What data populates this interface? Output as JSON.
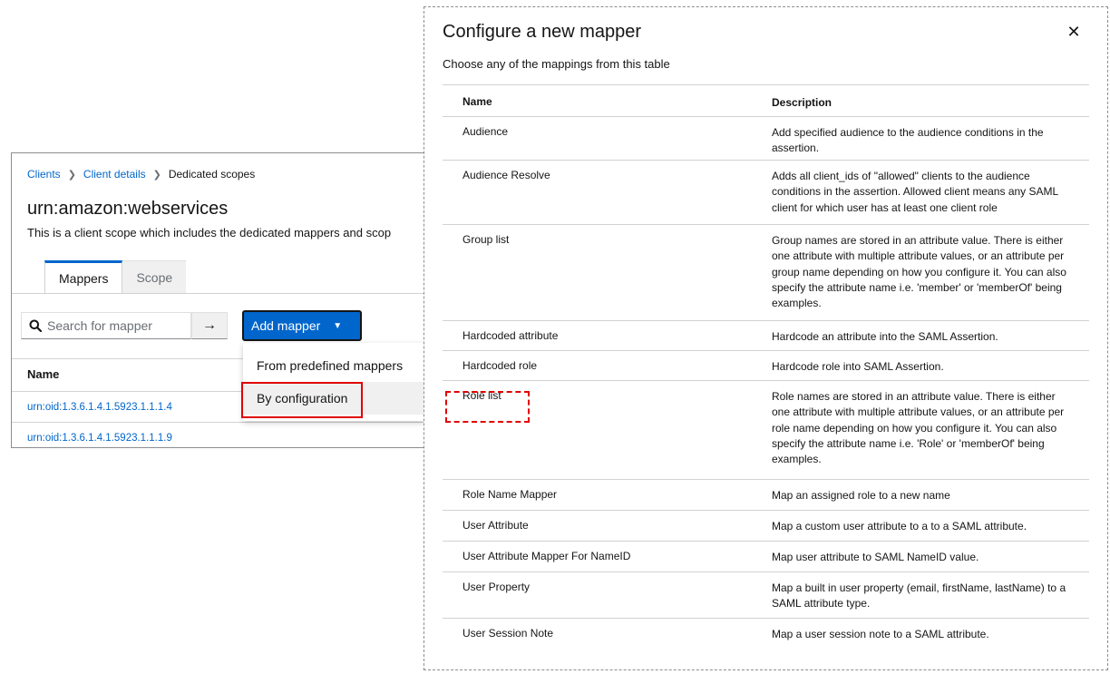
{
  "breadcrumb": {
    "items": [
      "Clients",
      "Client details"
    ],
    "current": "Dedicated scopes"
  },
  "page": {
    "title": "urn:amazon:webservices",
    "subtitle": "This is a client scope which includes the dedicated mappers and scop"
  },
  "tabs": [
    {
      "label": "Mappers",
      "active": true
    },
    {
      "label": "Scope",
      "active": false
    }
  ],
  "search": {
    "placeholder": "Search for mapper",
    "value": ""
  },
  "toolbar": {
    "add_mapper_label": "Add mapper"
  },
  "dropdown": {
    "items": [
      "From predefined mappers",
      "By configuration"
    ],
    "highlighted": "By configuration"
  },
  "mappers_table": {
    "header": "Name",
    "rows": [
      "urn:oid:1.3.6.1.4.1.5923.1.1.1.4",
      "urn:oid:1.3.6.1.4.1.5923.1.1.1.9"
    ]
  },
  "modal": {
    "title": "Configure a new mapper",
    "description": "Choose any of the mappings from this table",
    "columns": {
      "name": "Name",
      "description": "Description"
    },
    "rows": [
      {
        "name": "Audience",
        "description": "Add specified audience to the audience conditions in the assertion."
      },
      {
        "name": "Audience Resolve",
        "description": "Adds all client_ids of \"allowed\" clients to the audience conditions in the assertion. Allowed client means any SAML client for which user has at least one client role"
      },
      {
        "name": "Group list",
        "description": "Group names are stored in an attribute value. There is either one attribute with multiple attribute values, or an attribute per group name depending on how you configure it. You can also specify the attribute name i.e. 'member' or 'memberOf' being examples."
      },
      {
        "name": "Hardcoded attribute",
        "description": "Hardcode an attribute into the SAML Assertion."
      },
      {
        "name": "Hardcoded role",
        "description": "Hardcode role into SAML Assertion."
      },
      {
        "name": "Role list",
        "description": "Role names are stored in an attribute value. There is either one attribute with multiple attribute values, or an attribute per role name depending on how you configure it. You can also specify the attribute name i.e. 'Role' or 'memberOf' being examples."
      },
      {
        "name": "Role Name Mapper",
        "description": "Map an assigned role to a new name"
      },
      {
        "name": "User Attribute",
        "description": "Map a custom user attribute to a to a SAML attribute."
      },
      {
        "name": "User Attribute Mapper For NameID",
        "description": "Map user attribute to SAML NameID value."
      },
      {
        "name": "User Property",
        "description": "Map a built in user property (email, firstName, lastName) to a SAML attribute type."
      },
      {
        "name": "User Session Note",
        "description": "Map a user session note to a SAML attribute."
      }
    ]
  },
  "colors": {
    "link": "#0066cc",
    "primary_button": "#0066cc",
    "highlight_red": "#e00000",
    "border": "#d2d2d2"
  },
  "icons": [
    "search-icon",
    "arrow-right-icon",
    "caret-down-icon",
    "close-icon",
    "chevron-right-icon"
  ]
}
